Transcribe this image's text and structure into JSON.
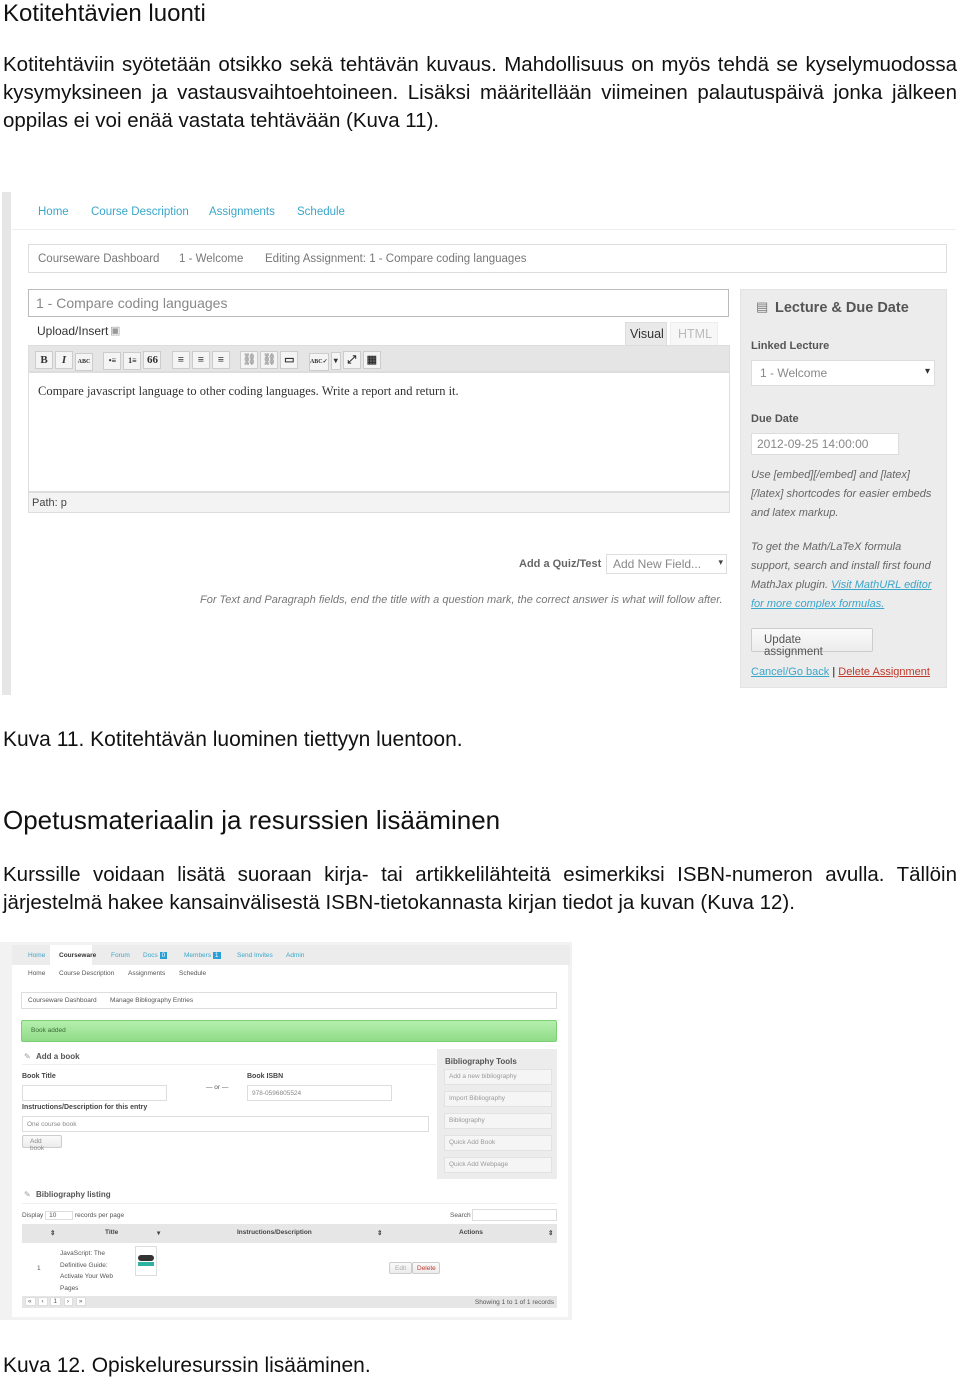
{
  "section1": {
    "title": "Kotitehtävien luonti",
    "paragraph": "Kotitehtäviin syötetään otsikko sekä tehtävän kuvaus. Mahdollisuus on myös tehdä se kyselymuodossa kysymyksineen ja vastausvaihtoehtoineen. Lisäksi määritellään viimeinen palautuspäivä jonka jälkeen oppilas ei voi enää vastata tehtävään (Kuva 11).",
    "caption": "Kuva 11. Kotitehtävän luominen tiettyyn luentoon."
  },
  "shot1": {
    "nav": [
      "Home",
      "Course Description",
      "Assignments",
      "Schedule"
    ],
    "breadcrumb": [
      "Courseware Dashboard",
      "1 - Welcome",
      "Editing Assignment: 1 - Compare coding languages"
    ],
    "title_value": "1 - Compare coding languages",
    "upload_label": "Upload/Insert",
    "tab_visual": "Visual",
    "tab_html": "HTML",
    "toolbar": [
      "B",
      "I",
      "ABC",
      "•≡",
      "1≡",
      "66",
      "≡",
      "≡",
      "≡",
      "⛓",
      "⛓",
      "▭",
      "ABC✓",
      "▾",
      "⤢",
      "▦"
    ],
    "editor_text": "Compare javascript language to other coding languages. Write a report and return it.",
    "path": "Path: p",
    "quiz_label": "Add a Quiz/Test",
    "quiz_select": "Add New Field...",
    "quiz_note": "For Text and Paragraph fields, end the title with a question mark, the correct answer is what will follow after.",
    "sidebar": {
      "title": "Lecture & Due Date",
      "linked_label": "Linked Lecture",
      "linked_value": "1 - Welcome",
      "due_label": "Due Date",
      "due_value": "2012-09-25 14:00:00",
      "help1": "Use [embed][/embed] and [latex][/latex] shortcodes for easier embeds and latex markup.",
      "help2": "To get the Math/LaTeX formula support, search and install first found MathJax plugin.",
      "help2_link": "Visit MathURL editor for more complex formulas.",
      "update": "Update assignment",
      "cancel": "Cancel/Go back",
      "sep": "|",
      "delete": "Delete Assignment"
    }
  },
  "section2": {
    "title": "Opetusmateriaalin ja resurssien lisääminen",
    "paragraph": "Kurssille voidaan lisätä suoraan kirja- tai artikkelilähteitä esimerkiksi ISBN-numeron avulla. Tällöin järjestelmä hakee kansainvälisestä ISBN-tietokannasta kirjan tiedot ja kuvan (Kuva 12).",
    "caption": "Kuva 12. Opiskeluresurssin lisääminen."
  },
  "shot2": {
    "topnav": [
      {
        "label": "Home"
      },
      {
        "label": "Courseware",
        "active": true
      },
      {
        "label": "Forum"
      },
      {
        "label": "Docs",
        "badge": "0"
      },
      {
        "label": "Members",
        "badge": "1"
      },
      {
        "label": "Send Invites"
      },
      {
        "label": "Admin"
      }
    ],
    "subnav": [
      "Home",
      "Course Description",
      "Assignments",
      "Schedule"
    ],
    "breadcrumb": [
      "Courseware Dashboard",
      "Manage Bibliography Entries"
    ],
    "alert": "Book added",
    "add_title": "Add a book",
    "book_title_label": "Book Title",
    "or": "— or —",
    "isbn_label": "Book ISBN",
    "isbn_value": "978-0596805524",
    "desc_label": "Instructions/Description for this entry",
    "desc_value": "One course book",
    "add_button": "Add book",
    "tools_title": "Bibliography Tools",
    "tools": [
      "Add a new bibliography",
      "Import Bibliography",
      "Bibliography",
      "Quick Add Book",
      "Quick Add Webpage"
    ],
    "listing_title": "Bibliography listing",
    "display": "Display",
    "per_page": "10",
    "records_per_page": "records per page",
    "search": "Search",
    "columns": [
      "Title",
      "Instructions/Description",
      "Actions"
    ],
    "row": {
      "num": "1",
      "title": "JavaScript: The Definitive Guide: Activate Your Web Pages",
      "edit": "Edit",
      "delete": "Delete"
    },
    "pager": [
      "«",
      "‹",
      "1",
      "›",
      "»"
    ],
    "showing": "Showing 1 to 1 of 1 records"
  },
  "colors": {
    "link": "#3aa6c9",
    "delete": "#c0392b",
    "alert": "#9fe39a"
  }
}
